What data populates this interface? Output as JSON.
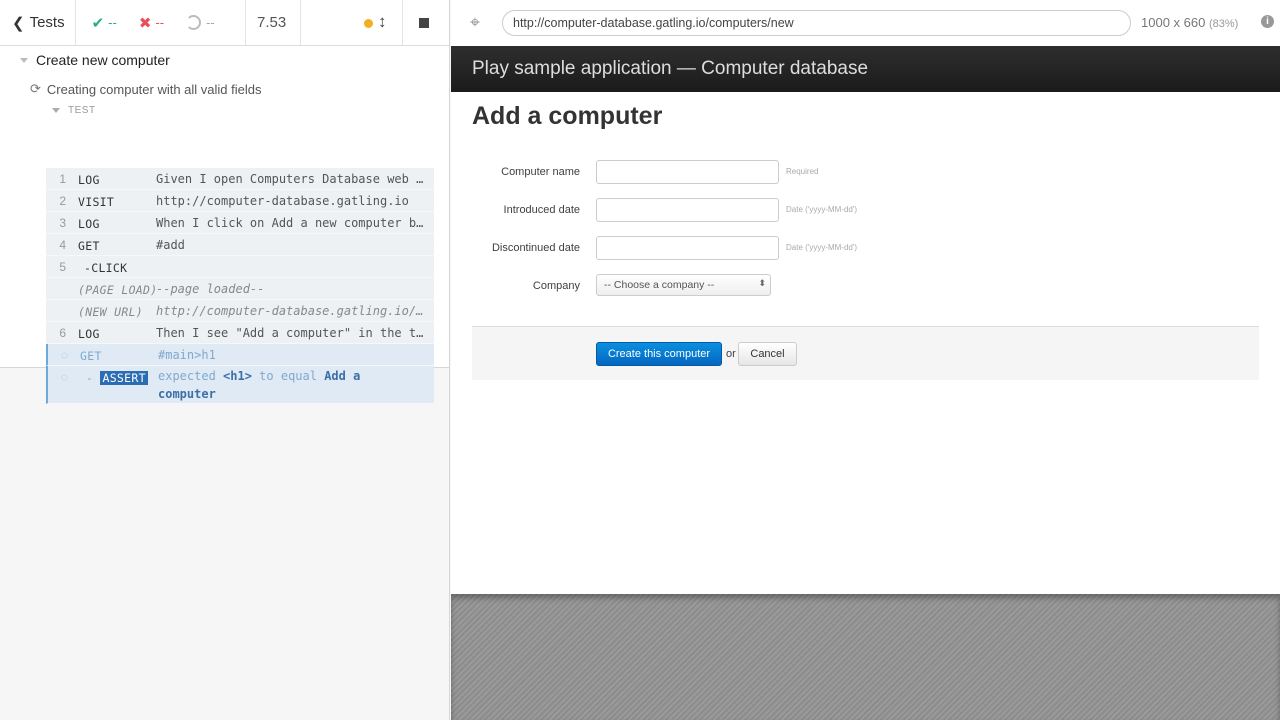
{
  "runner": {
    "tests_label": "Tests",
    "passed": "--",
    "failed": "--",
    "pending": "--",
    "duration": "7.53",
    "suite_title": "Create new computer",
    "test_title": "Creating computer with all valid fields",
    "test_section": "TEST",
    "commands": [
      {
        "num": "1",
        "name": "LOG",
        "msg": "Given I open Computers Database web page"
      },
      {
        "num": "2",
        "name": "VISIT",
        "msg": "http://computer-database.gatling.io"
      },
      {
        "num": "3",
        "name": "LOG",
        "msg": "When I click on Add a new computer button"
      },
      {
        "num": "4",
        "name": "GET",
        "msg": "#add"
      },
      {
        "num": "5",
        "name": "-CLICK",
        "msg": ""
      },
      {
        "num": "",
        "name": "(PAGE LOAD)",
        "msg": "--page loaded--"
      },
      {
        "num": "",
        "name": "(NEW URL)",
        "msg": "http://computer-database.gatling.io/computers/new"
      },
      {
        "num": "6",
        "name": "LOG",
        "msg": "Then I see \"Add a computer\" in the title"
      },
      {
        "num": "",
        "name": "GET",
        "msg": "#main>h1"
      }
    ],
    "assert": {
      "name": "ASSERT",
      "prefix": "-",
      "t1": "expected",
      "t2": "<h1>",
      "t3": "to equal",
      "t4": "Add a",
      "t5": "computer"
    }
  },
  "aut": {
    "url": "http://computer-database.gatling.io/computers/new",
    "viewport": "1000 x 660",
    "scale": "(83%)",
    "info": "i",
    "app_title": "Play sample application — Computer database",
    "heading": "Add a computer",
    "fields": [
      {
        "label": "Computer name",
        "help": "Required"
      },
      {
        "label": "Introduced date",
        "help": "Date ('yyyy-MM-dd')"
      },
      {
        "label": "Discontinued date",
        "help": "Date ('yyyy-MM-dd')"
      }
    ],
    "company_label": "Company",
    "company_selected": "-- Choose a company --",
    "create_label": "Create this computer",
    "or_label": "or",
    "cancel_label": "Cancel"
  }
}
